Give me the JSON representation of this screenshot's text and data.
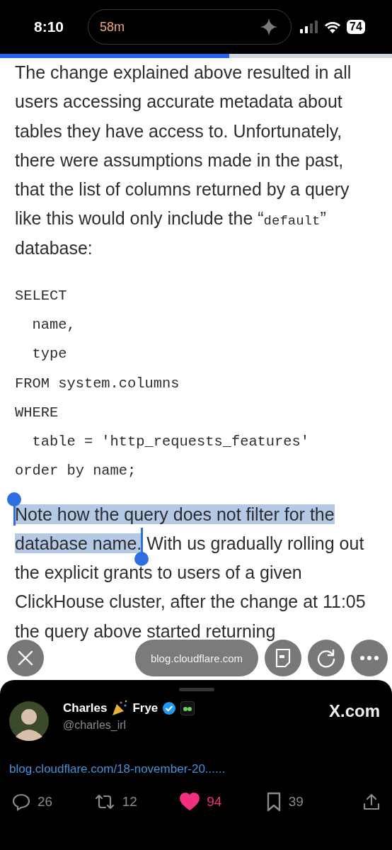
{
  "status_bar": {
    "time": "8:10",
    "island_timer": "58m",
    "battery": "74"
  },
  "reading_progress": {
    "level": 0.585
  },
  "article": {
    "intro": [
      {
        "kind": "text",
        "text": "The change explained above resulted in all users accessing accurate metadata about tables they have access to. Unfortunately, there were assumptions made in the past, that the list of columns returned by a query like this would only include the “"
      },
      {
        "kind": "code",
        "text": "default"
      },
      {
        "kind": "text",
        "text": "” database:"
      }
    ],
    "code_lines": [
      "SELECT",
      "  name,",
      "  type",
      "FROM system.columns",
      "WHERE",
      "  table = 'http_requests_features'",
      "order by name;"
    ],
    "paragraph": [
      {
        "text": "Note how the query does not filter for the database name.",
        "selected": true
      },
      {
        "text": " With us gradually rolling out the explicit grants to users of a given ClickHouse cluster, after the change at 11:05 the query above started returning",
        "selected": false
      }
    ]
  },
  "browser_toolbar": {
    "url": "blog.cloudflare.com"
  },
  "post": {
    "name_first": "Charles",
    "name_last": "Frye",
    "verified": true,
    "handle": "@charles_irl",
    "source": "X.com",
    "link": "blog.cloudflare.com/18-november-20......",
    "actions": [
      {
        "kind": "reply",
        "count": "26",
        "selected": false
      },
      {
        "kind": "repost",
        "count": "12",
        "selected": false
      },
      {
        "kind": "like",
        "count": "94",
        "selected": true
      },
      {
        "kind": "bookmark",
        "count": "39",
        "selected": false
      },
      {
        "kind": "share",
        "selected": false
      }
    ]
  }
}
